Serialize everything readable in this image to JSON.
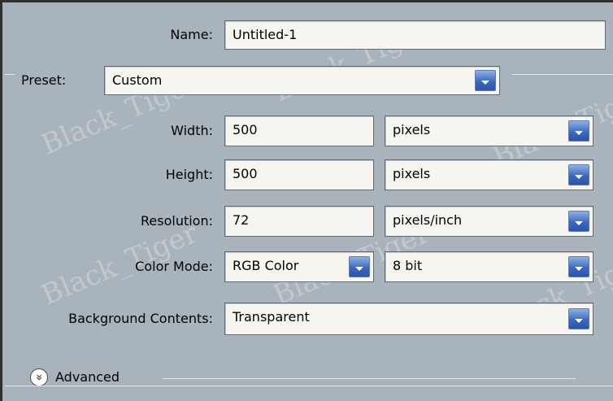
{
  "name": {
    "label": "Name:",
    "value": "Untitled-1"
  },
  "preset": {
    "label": "Preset:",
    "value": "Custom"
  },
  "width": {
    "label": "Width:",
    "value": "500",
    "unit": "pixels"
  },
  "height": {
    "label": "Height:",
    "value": "500",
    "unit": "pixels"
  },
  "resolution": {
    "label": "Resolution:",
    "value": "72",
    "unit": "pixels/inch"
  },
  "color_mode": {
    "label": "Color Mode:",
    "mode": "RGB Color",
    "depth": "8 bit"
  },
  "background": {
    "label": "Background Contents:",
    "value": "Transparent"
  },
  "advanced": {
    "label": "Advanced",
    "icon": "expand-double-chevron-icon"
  },
  "watermark": "Black_Tiger",
  "colors": {
    "panel": "#a9b3bc",
    "field": "#f7f5ef",
    "dropdown_button": "#3c69c1"
  }
}
